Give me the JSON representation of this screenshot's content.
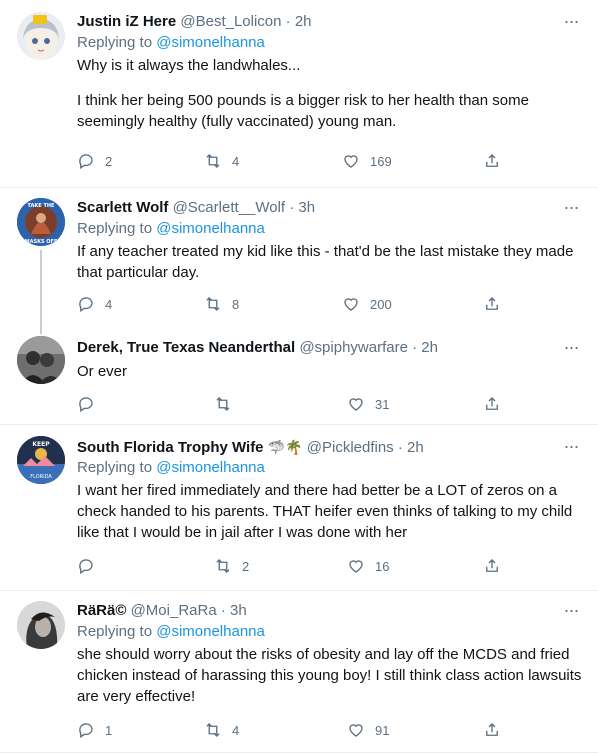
{
  "colors": {
    "link": "#1b95e0",
    "meta": "#5b7083",
    "text": "#0f1419",
    "divider": "#ebeef0"
  },
  "tweets": [
    {
      "name": "Justin iZ Here",
      "handle": "@Best_Lolicon",
      "time": "· 2h",
      "replying_prefix": "Replying to ",
      "replying_to": "@simonelhanna",
      "text1": "Why is it always the landwhales...",
      "text2": "I think her being 500 pounds is a bigger risk to her health than some seemingly healthy (fully vaccinated) young man.",
      "replies": "2",
      "retweets": "4",
      "likes": "169"
    },
    {
      "name": "Scarlett Wolf",
      "handle": "@Scarlett__Wolf",
      "time": "· 3h",
      "replying_prefix": "Replying to ",
      "replying_to": "@simonelhanna",
      "avatar_text": "TAKE THE MASKS OFF",
      "text1": "If any teacher treated my kid like this - that'd be the last mistake they made that particular day.",
      "replies": "4",
      "retweets": "8",
      "likes": "200"
    },
    {
      "name": "Derek, True Texas Neanderthal",
      "handle": "@spiphywarfare",
      "time": "· 2h",
      "text1": "Or ever",
      "replies": "",
      "retweets": "",
      "likes": "31"
    },
    {
      "name": "South Florida Trophy Wife",
      "name_emoji": "🦈🌴",
      "handle": "@Pickledfins",
      "time": "· 2h",
      "replying_prefix": "Replying to ",
      "replying_to": "@simonelhanna",
      "avatar_text": "KEEP CALM SOUTH FLORIDA",
      "text1": "I want her fired immediately and there had better be a LOT of zeros on a check handed to his parents.  THAT heifer even thinks of talking to my child like that I would be in jail after I was done with her",
      "replies": "",
      "retweets": "2",
      "likes": "16"
    },
    {
      "name": "RäRä©",
      "handle": "@Moi_RaRa",
      "time": "· 3h",
      "replying_prefix": "Replying to ",
      "replying_to": "@simonelhanna",
      "text1": "she should worry about the risks of obesity and lay off the MCDS and fried chicken instead of harassing this young boy! I still think class action lawsuits are very effective!",
      "replies": "1",
      "retweets": "4",
      "likes": "91"
    }
  ]
}
